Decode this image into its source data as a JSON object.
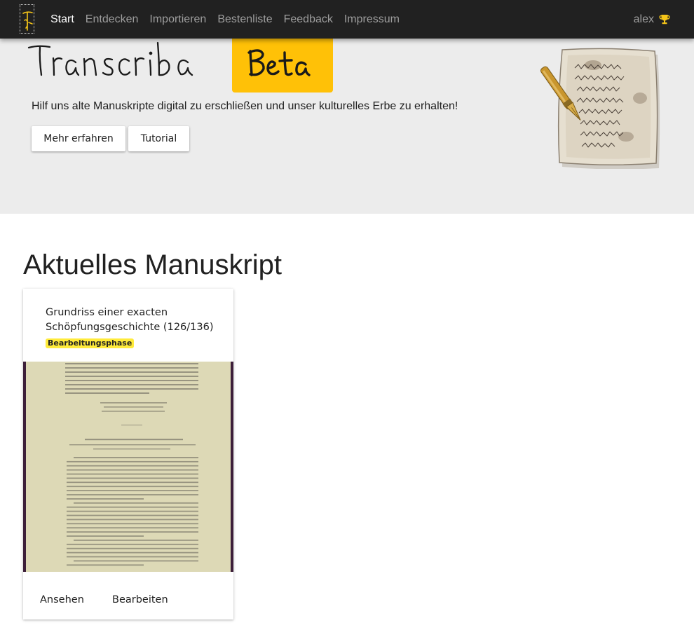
{
  "navbar": {
    "links": [
      {
        "label": "Start",
        "active": true
      },
      {
        "label": "Entdecken",
        "active": false
      },
      {
        "label": "Importieren",
        "active": false
      },
      {
        "label": "Bestenliste",
        "active": false
      },
      {
        "label": "Feedback",
        "active": false
      },
      {
        "label": "Impressum",
        "active": false
      }
    ],
    "user": {
      "name": "alex",
      "icon": "trophy-icon",
      "icon_color": "#f5c518"
    }
  },
  "hero": {
    "logo_text": "Transcriba",
    "badge_text": "Beta",
    "badge_color": "#ffc107",
    "tagline": "Hilf uns alte Manuskripte digital zu erschließen und unser kulturelles Erbe zu erhalten!",
    "buttons": {
      "more": "Mehr erfahren",
      "tutorial": "Tutorial"
    }
  },
  "main": {
    "section_title": "Aktuelles Manuskript",
    "card": {
      "title": "Grundriss einer exacten Schöpfungsgeschichte (126/136)",
      "phase": "Bearbeitungsphase",
      "phase_color": "#ffeb3b",
      "actions": {
        "view": "Ansehen",
        "edit": "Bearbeiten"
      }
    }
  }
}
